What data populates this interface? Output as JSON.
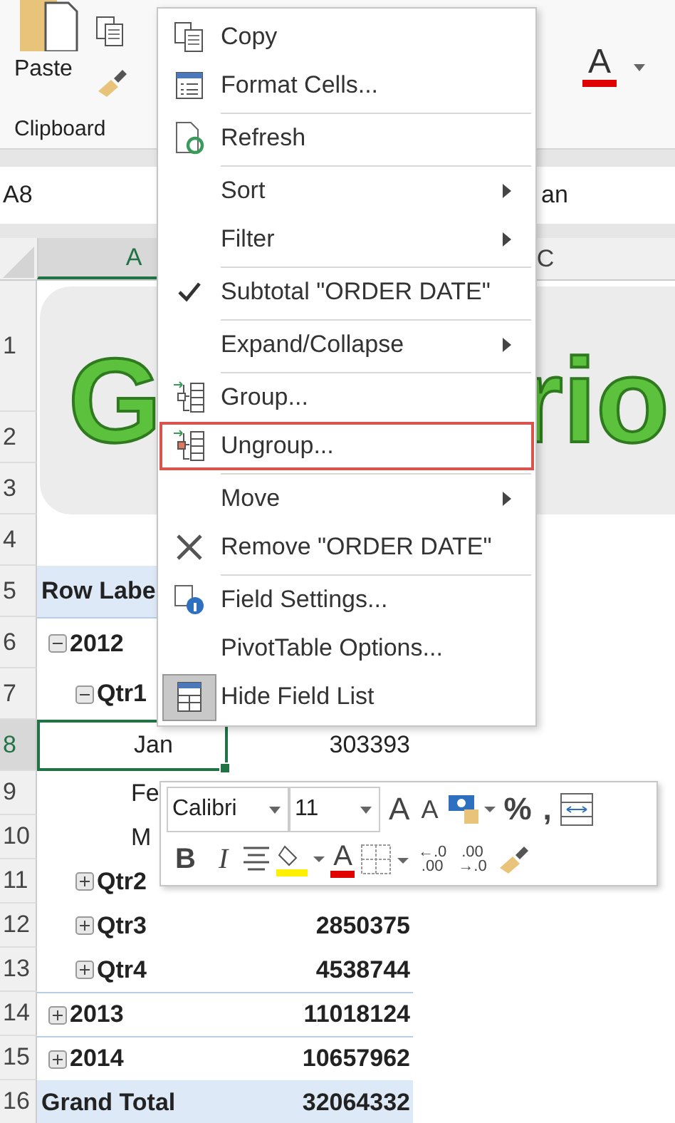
{
  "ribbon": {
    "paste_label": "Paste",
    "group_label": "Clipboard",
    "font_color_glyph": "A"
  },
  "formula_bar": {
    "name_box": "A8",
    "value": "an"
  },
  "column_headers": [
    {
      "label": "A",
      "selected": true
    },
    {
      "label": "C",
      "selected": false
    }
  ],
  "title_banner": {
    "parts": [
      "G",
      "rio"
    ]
  },
  "rows": [
    {
      "number": "1",
      "selected": false,
      "kind": "empty"
    },
    {
      "number": "2",
      "selected": false,
      "kind": "empty"
    },
    {
      "number": "3",
      "selected": false,
      "kind": "empty"
    },
    {
      "number": "4",
      "selected": false,
      "kind": "empty"
    },
    {
      "number": "5",
      "selected": false,
      "kind": "header",
      "label": "Row Labe"
    },
    {
      "number": "6",
      "selected": false,
      "kind": "year",
      "label": "2012",
      "expanded": true
    },
    {
      "number": "7",
      "selected": false,
      "kind": "quarter",
      "label": "Qtr1",
      "expanded": true
    },
    {
      "number": "8",
      "selected": true,
      "kind": "month",
      "label": "Jan",
      "value": "303393"
    },
    {
      "number": "9",
      "selected": false,
      "kind": "month",
      "label": "Fe"
    },
    {
      "number": "10",
      "selected": false,
      "kind": "month",
      "label": "M"
    },
    {
      "number": "11",
      "selected": false,
      "kind": "quarter",
      "label": "Qtr2",
      "expanded": false
    },
    {
      "number": "12",
      "selected": false,
      "kind": "quarter",
      "label": "Qtr3",
      "value": "2850375",
      "expanded": false
    },
    {
      "number": "13",
      "selected": false,
      "kind": "quarter",
      "label": "Qtr4",
      "value": "4538744",
      "expanded": false
    },
    {
      "number": "14",
      "selected": false,
      "kind": "year",
      "label": "2013",
      "value": "11018124",
      "expanded": false
    },
    {
      "number": "15",
      "selected": false,
      "kind": "year",
      "label": "2014",
      "value": "10657962",
      "expanded": false
    },
    {
      "number": "16",
      "selected": false,
      "kind": "total",
      "label": "Grand Total",
      "value": "32064332"
    }
  ],
  "context_menu": {
    "items": [
      {
        "label": "Copy",
        "kind": "copy",
        "submenu": false,
        "checked": false,
        "highlighted": false,
        "separator_before": false
      },
      {
        "label": "Format Cells...",
        "kind": "format",
        "submenu": false,
        "checked": false,
        "highlighted": false,
        "separator_before": false
      },
      {
        "label": "Refresh",
        "kind": "refresh",
        "submenu": false,
        "checked": false,
        "highlighted": false,
        "separator_before": true
      },
      {
        "label": "Sort",
        "kind": "plain",
        "submenu": true,
        "checked": false,
        "highlighted": false,
        "separator_before": true
      },
      {
        "label": "Filter",
        "kind": "plain",
        "submenu": true,
        "checked": false,
        "highlighted": false,
        "separator_before": false
      },
      {
        "label": "Subtotal \"ORDER DATE\"",
        "kind": "plain",
        "submenu": false,
        "checked": true,
        "highlighted": false,
        "separator_before": true
      },
      {
        "label": "Expand/Collapse",
        "kind": "plain",
        "submenu": true,
        "checked": false,
        "highlighted": false,
        "separator_before": true
      },
      {
        "label": "Group...",
        "kind": "group",
        "submenu": false,
        "checked": false,
        "highlighted": false,
        "separator_before": true
      },
      {
        "label": "Ungroup...",
        "kind": "ungroup",
        "submenu": false,
        "checked": false,
        "highlighted": true,
        "separator_before": false
      },
      {
        "label": "Move",
        "kind": "plain",
        "submenu": true,
        "checked": false,
        "highlighted": false,
        "separator_before": true
      },
      {
        "label": "Remove \"ORDER DATE\"",
        "kind": "remove",
        "submenu": false,
        "checked": false,
        "highlighted": false,
        "separator_before": false
      },
      {
        "label": "Field Settings...",
        "kind": "settings",
        "submenu": false,
        "checked": false,
        "highlighted": false,
        "separator_before": true
      },
      {
        "label": "PivotTable Options...",
        "kind": "plain",
        "submenu": false,
        "checked": false,
        "highlighted": false,
        "separator_before": false
      },
      {
        "label": "Hide Field List",
        "kind": "fieldlist",
        "submenu": false,
        "checked": true,
        "highlighted": false,
        "separator_before": false
      }
    ]
  },
  "mini_toolbar": {
    "font": "Calibri",
    "size": "11",
    "row1": [
      {
        "kind": "grow-font",
        "text": "A"
      },
      {
        "kind": "shrink-font",
        "text": "A"
      },
      {
        "kind": "accounting"
      },
      {
        "kind": "symbol",
        "text": "%"
      },
      {
        "kind": "symbol",
        "text": ","
      },
      {
        "kind": "wrap"
      }
    ],
    "row2": [
      {
        "kind": "bold",
        "text": "B"
      },
      {
        "kind": "italic",
        "text": "I"
      },
      {
        "kind": "center"
      },
      {
        "kind": "fill-color"
      },
      {
        "kind": "font-color",
        "text": "A"
      },
      {
        "kind": "borders"
      },
      {
        "kind": "decimal",
        "lines": [
          "←.0",
          ".00"
        ]
      },
      {
        "kind": "decimal",
        "lines": [
          ".00",
          "→.0"
        ]
      },
      {
        "kind": "painter"
      }
    ]
  }
}
